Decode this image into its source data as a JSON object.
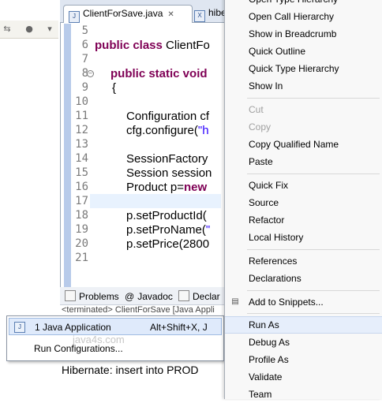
{
  "editor": {
    "tabs": [
      {
        "label": "ClientForSave.java",
        "icon": "java-file-icon"
      },
      {
        "label": "hibe",
        "icon": "xml-file-icon"
      }
    ],
    "line_numbers": [
      "5",
      "6",
      "7",
      "8",
      "9",
      "10",
      "11",
      "12",
      "13",
      "14",
      "15",
      "16",
      "17",
      "18",
      "19",
      "20",
      "21"
    ],
    "code": {
      "l6_kw": "public class ",
      "l6_rest": "ClientFo",
      "l8_kw": "public static void",
      "l9": "{",
      "l11": "Configuration cf",
      "l12_a": "cfg.configure(",
      "l12_str": "\"h",
      "l14": "SessionFactory",
      "l15": "Session session",
      "l16_a": "Product p=",
      "l16_kw": "new",
      "l18": "p.setProductId(",
      "l19_a": "p.setProName(",
      "l19_str": "\"",
      "l20": "p.setPrice(2800"
    }
  },
  "bottom_panel": {
    "tabs": [
      {
        "label": "Problems"
      },
      {
        "label": "Javadoc",
        "icon": "@"
      },
      {
        "label": "Declar"
      }
    ],
    "terminated_text": "<terminated> ClientForSave [Java Appli",
    "console_output": "Hibernate: insert into PROD"
  },
  "submenu": {
    "items": [
      {
        "label": "1 Java Application",
        "shortcut": "Alt+Shift+X, J",
        "icon": "java-app-icon"
      },
      {
        "label": "Run Configurations..."
      }
    ]
  },
  "watermark": "java4s.com",
  "context_menu": {
    "items": [
      {
        "label": "Open Type Hierarchy"
      },
      {
        "label": "Open Call Hierarchy"
      },
      {
        "label": "Show in Breadcrumb"
      },
      {
        "label": "Quick Outline"
      },
      {
        "label": "Quick Type Hierarchy"
      },
      {
        "label": "Show In"
      },
      {
        "label": "Cut",
        "disabled": true
      },
      {
        "label": "Copy",
        "disabled": true
      },
      {
        "label": "Copy Qualified Name"
      },
      {
        "label": "Paste"
      },
      {
        "label": "Quick Fix"
      },
      {
        "label": "Source"
      },
      {
        "label": "Refactor"
      },
      {
        "label": "Local History"
      },
      {
        "label": "References"
      },
      {
        "label": "Declarations"
      },
      {
        "label": "Add to Snippets..."
      },
      {
        "label": "Run As"
      },
      {
        "label": "Debug As"
      },
      {
        "label": "Profile As"
      },
      {
        "label": "Validate"
      },
      {
        "label": "Team"
      }
    ]
  }
}
